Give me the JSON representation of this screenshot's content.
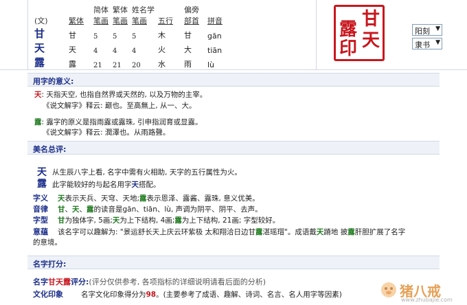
{
  "char_table": {
    "header_row1": {
      "simp_strokes": "简体",
      "trad_strokes": "繁体",
      "name_strokes": "姓名学",
      "radical": "偏旁"
    },
    "header_row2": {
      "wen": "(文)",
      "trad": "繁体",
      "simp_strokes": "笔画",
      "trad_strokes": "笔画",
      "name_strokes": "笔画",
      "wuxing": "五行",
      "radical": "部首",
      "pinyin": "拼音"
    },
    "rows": [
      {
        "char": "甘",
        "trad": "甘",
        "simp": "5",
        "trad_n": "5",
        "name_n": "5",
        "wuxing": "木",
        "radical": "甘",
        "pinyin": "gān"
      },
      {
        "char": "天",
        "trad": "天",
        "simp": "4",
        "trad_n": "4",
        "name_n": "4",
        "wuxing": "火",
        "radical": "大",
        "pinyin": "tiān"
      },
      {
        "char": "露",
        "trad": "露",
        "simp": "21",
        "trad_n": "21",
        "name_n": "20",
        "wuxing": "水",
        "radical": "雨",
        "pinyin": "lù"
      }
    ]
  },
  "seal": {
    "c1": "甘",
    "c2": "露",
    "c3": "天",
    "c4": "印"
  },
  "selects": {
    "style": "阳刻",
    "font": "隶书"
  },
  "section1": {
    "title": "用字的意义:",
    "tian_char": "天",
    "tian_line1": ": 天指天空, 也指自然界或天然的, 以及万物的主宰。",
    "tian_line2": "《说文解字》释云: 巅也。至高無上, 从一、大。",
    "lu_char": "露",
    "lu_line1": ": 露字的原义是指雨露或露珠, 引申指润育或显露。",
    "lu_line2": "《说文解字》释云: 潤澤也。从雨路聲。"
  },
  "section2": {
    "title": "美名总评:",
    "big1": "天",
    "big2": "露",
    "line1": "从生辰八字上看, 名字中需有火相助, 天字的五行属性为火。",
    "line2_a": "此字能较好的与起名用字",
    "line2_b": "天",
    "line2_c": "搭配。",
    "ziyi_label": "字义",
    "ziyi_a": "天",
    "ziyi_b": "表示天兵、天穹、天地;",
    "ziyi_c": "露",
    "ziyi_d": "表示恩泽、露酱、露珠, 意义优美。",
    "yinlu_label": "音律",
    "yinlu_a": "甘",
    "yinlu_b": "、",
    "yinlu_c": "天",
    "yinlu_d": "、",
    "yinlu_e": "露",
    "yinlu_f": "的读音是gān、tiān、lù, 声调为阴平、阴平、去声。",
    "zixing_label": "字型",
    "zixing_a": "甘",
    "zixing_b": "为独体字, 5画;",
    "zixing_c": "天",
    "zixing_d": "为上下结构, 4画;",
    "zixing_e": "露",
    "zixing_f": "为上下结构, 21画; 字型较好。",
    "yiyun_label": "意蕴",
    "yiyun_a": "该名字可以趣解为: \"景运舒长天上庆云环紫极  太和翔洽日边甘",
    "yiyun_b": "露",
    "yiyun_c": "湛瑶瑁\"。成语戴",
    "yiyun_d": "天",
    "yiyun_e": "蹐地  披",
    "yiyun_f": "露",
    "yiyun_g": "肝胆扩展了名字",
    "yiyun_h": "的意境。"
  },
  "section3": {
    "title": "名字打分:",
    "score_prefix": "名字",
    "score_name": "甘天露",
    "score_suffix": "评分:",
    "score_note": "(评分仅供参考, 各项指标的详细说明请看后面的分析)",
    "wenhua_label": "文化印象",
    "wenhua_a": "名字文化印象得分为",
    "wenhua_score": "98",
    "wenhua_b": "。(主要参考了成语、趣解、诗词、名言、名人用字等因素)"
  },
  "watermark": {
    "text": "猪八戒",
    "url": "www.zhubajie.com"
  },
  "colors": {
    "accent": "#1d2f8a",
    "seal_red": "#c8161d",
    "green": "#1e7a1e",
    "section_bg": "#eef2f8"
  }
}
